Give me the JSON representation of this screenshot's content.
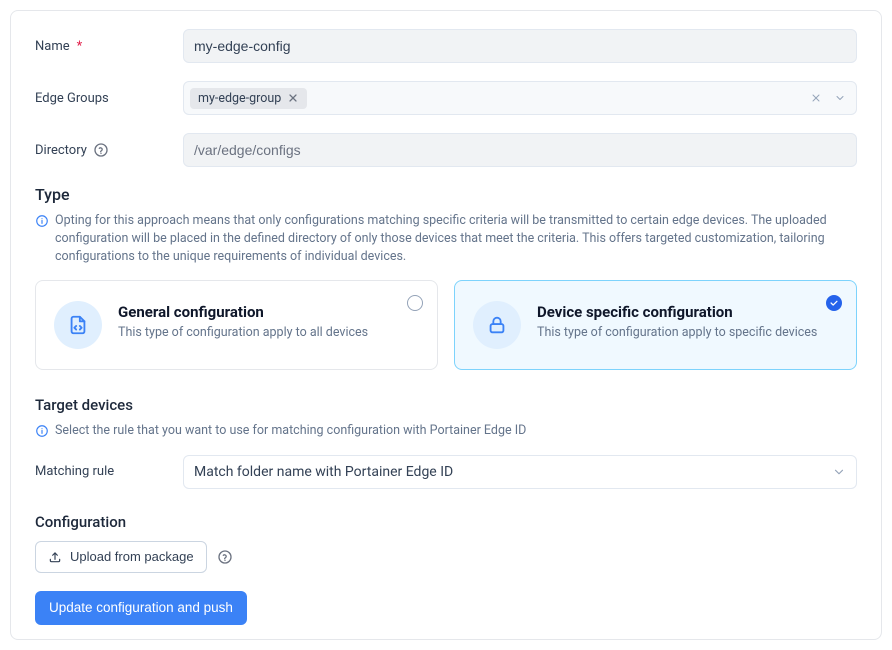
{
  "form": {
    "name": {
      "label": "Name",
      "value": "my-edge-config"
    },
    "edgeGroups": {
      "label": "Edge Groups",
      "tag": "my-edge-group"
    },
    "directory": {
      "label": "Directory",
      "value": "/var/edge/configs"
    }
  },
  "typeSection": {
    "title": "Type",
    "info": "Opting for this approach means that only configurations matching specific criteria will be transmitted to certain edge devices. The uploaded configuration will be placed in the defined directory of only those devices that meet the criteria. This offers targeted customization, tailoring configurations to the unique requirements of individual devices.",
    "cards": {
      "general": {
        "title": "General configuration",
        "desc": "This type of configuration apply to all devices"
      },
      "device": {
        "title": "Device specific configuration",
        "desc": "This type of configuration apply to specific devices"
      }
    }
  },
  "targetSection": {
    "title": "Target devices",
    "info": "Select the rule that you want to use for matching configuration with Portainer Edge ID",
    "matchingRule": {
      "label": "Matching rule",
      "selected": "Match folder name with Portainer Edge ID"
    }
  },
  "configSection": {
    "title": "Configuration",
    "uploadLabel": "Upload from package"
  },
  "actions": {
    "submit": "Update configuration and push"
  }
}
